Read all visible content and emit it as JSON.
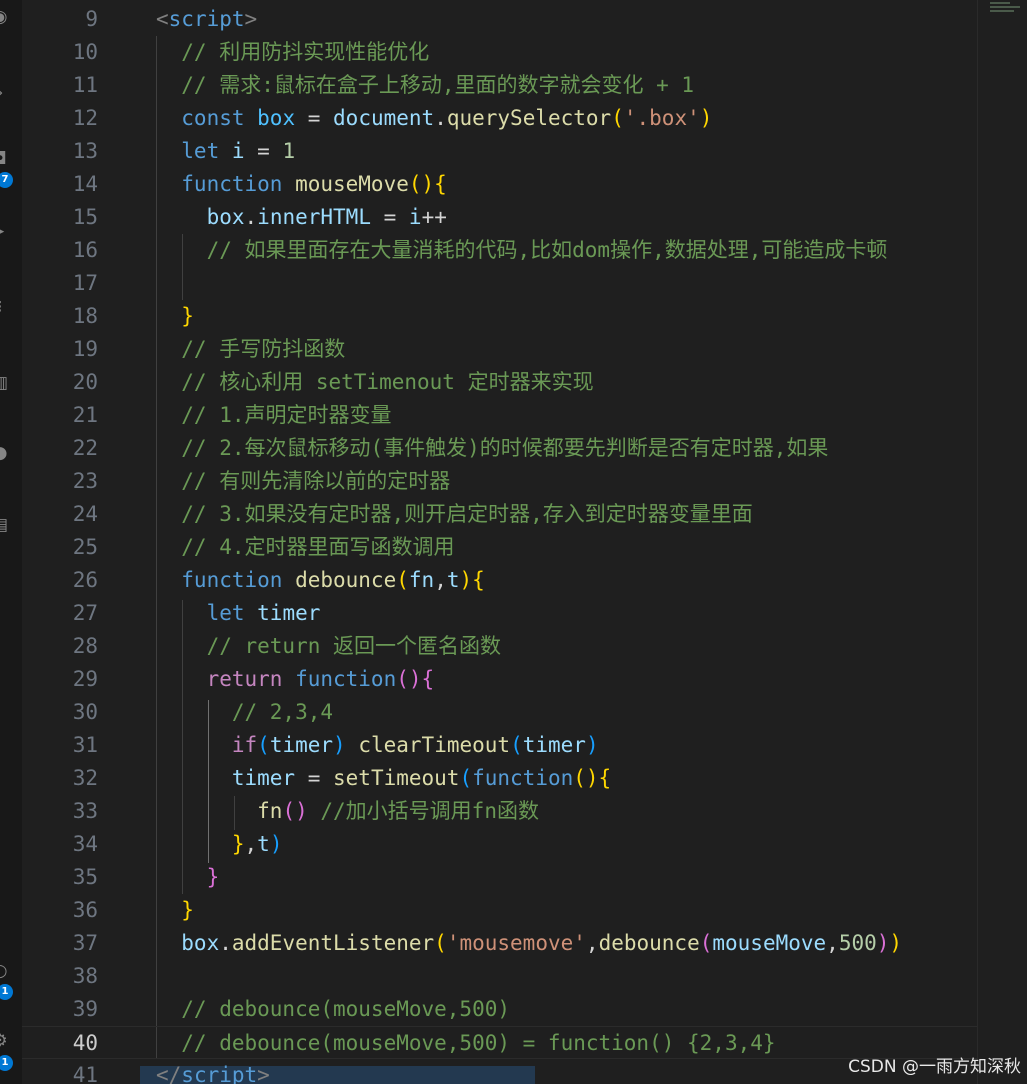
{
  "activity_bar": {
    "badges": [
      "7",
      "1",
      "1"
    ],
    "colors": {
      "badge": "#0078d4",
      "background": "#181818"
    }
  },
  "editor": {
    "current_line": 40,
    "colors": {
      "background": "#1f1f1f",
      "comment": "#6a9955",
      "keyword": "#569cd6",
      "control": "#c586c0",
      "variable": "#9cdcfe",
      "function": "#dcdcaa",
      "string": "#ce9178",
      "number": "#b5cea8",
      "bracket_1": "#ffd700",
      "bracket_2": "#da70d6",
      "bracket_3": "#179fff"
    },
    "lines": [
      {
        "number": "9",
        "tokens": [
          [
            "tag",
            "<"
          ],
          [
            "tagname",
            "script"
          ],
          [
            "tag",
            ">"
          ]
        ]
      },
      {
        "number": "10",
        "tokens": [
          [
            "com",
            "  // 利用防抖实现性能优化"
          ]
        ]
      },
      {
        "number": "11",
        "tokens": [
          [
            "com",
            "  // 需求:鼠标在盒子上移动,里面的数字就会变化 + 1"
          ]
        ]
      },
      {
        "number": "12",
        "tokens": [
          [
            "kw",
            "  const "
          ],
          [
            "const",
            "box"
          ],
          [
            "op",
            " = "
          ],
          [
            "var",
            "document"
          ],
          [
            "op",
            "."
          ],
          [
            "fn",
            "querySelector"
          ],
          [
            "b1",
            "("
          ],
          [
            "str",
            "'.box'"
          ],
          [
            "b1",
            ")"
          ]
        ]
      },
      {
        "number": "13",
        "tokens": [
          [
            "kw",
            "  let "
          ],
          [
            "var",
            "i"
          ],
          [
            "op",
            " = "
          ],
          [
            "num",
            "1"
          ]
        ]
      },
      {
        "number": "14",
        "tokens": [
          [
            "kw",
            "  function "
          ],
          [
            "fn",
            "mouseMove"
          ],
          [
            "b1",
            "(){"
          ]
        ]
      },
      {
        "number": "15",
        "tokens": [
          [
            "var",
            "    box"
          ],
          [
            "op",
            "."
          ],
          [
            "var",
            "innerHTML"
          ],
          [
            "op",
            " = "
          ],
          [
            "var",
            "i"
          ],
          [
            "op",
            "++"
          ]
        ]
      },
      {
        "number": "16",
        "tokens": [
          [
            "com",
            "    // 如果里面存在大量消耗的代码,比如dom操作,数据处理,可能造成卡顿"
          ]
        ]
      },
      {
        "number": "17",
        "tokens": []
      },
      {
        "number": "18",
        "tokens": [
          [
            "b1",
            "  }"
          ]
        ]
      },
      {
        "number": "19",
        "tokens": [
          [
            "com",
            "  // 手写防抖函数"
          ]
        ]
      },
      {
        "number": "20",
        "tokens": [
          [
            "com",
            "  // 核心利用 setTimenout 定时器来实现"
          ]
        ]
      },
      {
        "number": "21",
        "tokens": [
          [
            "com",
            "  // 1.声明定时器变量"
          ]
        ]
      },
      {
        "number": "22",
        "tokens": [
          [
            "com",
            "  // 2.每次鼠标移动(事件触发)的时候都要先判断是否有定时器,如果"
          ]
        ]
      },
      {
        "number": "23",
        "tokens": [
          [
            "com",
            "  // 有则先清除以前的定时器"
          ]
        ]
      },
      {
        "number": "24",
        "tokens": [
          [
            "com",
            "  // 3.如果没有定时器,则开启定时器,存入到定时器变量里面"
          ]
        ]
      },
      {
        "number": "25",
        "tokens": [
          [
            "com",
            "  // 4.定时器里面写函数调用"
          ]
        ]
      },
      {
        "number": "26",
        "tokens": [
          [
            "kw",
            "  function "
          ],
          [
            "fn",
            "debounce"
          ],
          [
            "b1",
            "("
          ],
          [
            "var",
            "fn"
          ],
          [
            "op",
            ","
          ],
          [
            "var",
            "t"
          ],
          [
            "b1",
            ")"
          ],
          [
            "b1",
            "{"
          ]
        ]
      },
      {
        "number": "27",
        "tokens": [
          [
            "kw",
            "    let "
          ],
          [
            "var",
            "timer"
          ]
        ]
      },
      {
        "number": "28",
        "tokens": [
          [
            "com",
            "    // return 返回一个匿名函数"
          ]
        ]
      },
      {
        "number": "29",
        "tokens": [
          [
            "ctrl",
            "    return "
          ],
          [
            "kw",
            "function"
          ],
          [
            "b2",
            "(){"
          ]
        ]
      },
      {
        "number": "30",
        "tokens": [
          [
            "com",
            "      // 2,3,4"
          ]
        ]
      },
      {
        "number": "31",
        "tokens": [
          [
            "ctrl",
            "      if"
          ],
          [
            "b3",
            "("
          ],
          [
            "var",
            "timer"
          ],
          [
            "b3",
            ")"
          ],
          [
            "op",
            " "
          ],
          [
            "fn",
            "clearTimeout"
          ],
          [
            "b3",
            "("
          ],
          [
            "var",
            "timer"
          ],
          [
            "b3",
            ")"
          ]
        ]
      },
      {
        "number": "32",
        "tokens": [
          [
            "var",
            "      timer"
          ],
          [
            "op",
            " = "
          ],
          [
            "fn",
            "setTimeout"
          ],
          [
            "b3",
            "("
          ],
          [
            "kw",
            "function"
          ],
          [
            "b1",
            "(){"
          ]
        ]
      },
      {
        "number": "33",
        "tokens": [
          [
            "fn",
            "        fn"
          ],
          [
            "b2",
            "()"
          ],
          [
            "op",
            " "
          ],
          [
            "com",
            "//加小括号调用fn函数"
          ]
        ]
      },
      {
        "number": "34",
        "tokens": [
          [
            "b1",
            "      }"
          ],
          [
            "op",
            ","
          ],
          [
            "var",
            "t"
          ],
          [
            "b3",
            ")"
          ]
        ]
      },
      {
        "number": "35",
        "tokens": [
          [
            "b2",
            "    }"
          ]
        ]
      },
      {
        "number": "36",
        "tokens": [
          [
            "b1",
            "  }"
          ]
        ]
      },
      {
        "number": "37",
        "tokens": [
          [
            "var",
            "  box"
          ],
          [
            "op",
            "."
          ],
          [
            "fn",
            "addEventListener"
          ],
          [
            "b1",
            "("
          ],
          [
            "str",
            "'mousemove'"
          ],
          [
            "op",
            ","
          ],
          [
            "fn",
            "debounce"
          ],
          [
            "b2",
            "("
          ],
          [
            "var",
            "mouseMove"
          ],
          [
            "op",
            ","
          ],
          [
            "num",
            "500"
          ],
          [
            "b2",
            ")"
          ],
          [
            "b1",
            ")"
          ]
        ]
      },
      {
        "number": "38",
        "tokens": []
      },
      {
        "number": "39",
        "tokens": [
          [
            "com",
            "  // debounce(mouseMove,500)"
          ]
        ]
      },
      {
        "number": "40",
        "tokens": [
          [
            "com",
            "  // debounce(mouseMove,500) = function() {2,3,4}"
          ]
        ]
      },
      {
        "number": "41",
        "tokens": [
          [
            "tag",
            "</"
          ],
          [
            "tagname",
            "script"
          ],
          [
            "tag",
            ">"
          ]
        ]
      }
    ]
  },
  "watermark": "CSDN @一雨方知深秋"
}
